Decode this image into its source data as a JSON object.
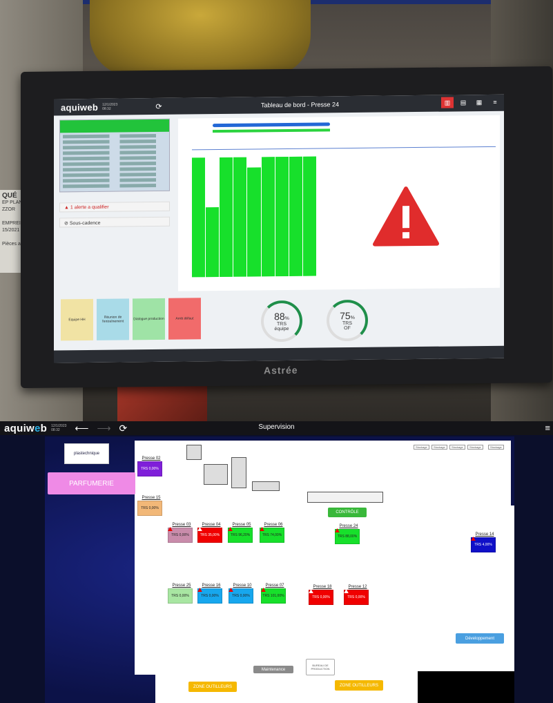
{
  "photo": {
    "sticker_lines": [
      "QUÉ",
      "EP PLAN ETT",
      "ZZOR",
      "EMPREINTE(S)",
      "15/2021",
      "Pièces avec"
    ],
    "bezel_brand": "Astrée"
  },
  "screen": {
    "logo": "aquiweb",
    "date_line1": "12/1/2023",
    "date_line2": "08:32",
    "refresh_icon": "refresh-icon",
    "title": "Tableau de bord - Presse 24",
    "header_icons": [
      "chart-icon",
      "list-icon",
      "calendar-icon",
      "menu-icon"
    ],
    "alert_text": "1 alerte a qualifier",
    "perf_text": "Sous-cadence",
    "tiles": [
      {
        "label": "Equipe HH",
        "color": "#f1e3a4"
      },
      {
        "label": "Réunion de l'entraînement",
        "color": "#a9dbe8"
      },
      {
        "label": "Dialogue production",
        "color": "#9fe3a6"
      },
      {
        "label": "Arrêt défaut",
        "color": "#f16b6b"
      }
    ],
    "gauge1": {
      "value": "88",
      "unit": "%",
      "l1": "TRS",
      "l2": "équipe"
    },
    "gauge2": {
      "value": "75",
      "unit": "%",
      "l1": "TRS",
      "l2": "OF"
    }
  },
  "app": {
    "logo_a": "aquiw",
    "logo_b": "e",
    "logo_c": "b",
    "date_line1": "12/1/2023",
    "date_line2": "08:32",
    "title": "Supervision",
    "back_icon": "arrow-left-icon",
    "forward_icon": "arrow-right-icon",
    "refresh_icon": "refresh-icon",
    "menu_icon": "menu-icon",
    "logo_box_text": "plastechnique",
    "zone_parfumerie": "PARFUMERIE",
    "zone_controle": "CONTRÔLE",
    "zone_developpement": "Développement",
    "zone_maintenance": "Maintenance",
    "zone_bureau": "BUREAU DE PRODUCTION",
    "zone_outilleurs_1": "ZONE OUTILLEURS",
    "zone_outilleurs_2": "ZONE OUTILLEURS",
    "stockage": "Stockage",
    "presses": [
      {
        "name": "Presse 02",
        "trs": "TRS 0,00%",
        "color": "#7f1fd9",
        "warn": false
      },
      {
        "name": "Presse 15",
        "trs": "TRS 0,00%",
        "color": "#f2b878",
        "warn": false
      },
      {
        "name": "Presse 03",
        "trs": "TRS 0,00%",
        "color": "#c98cab",
        "warn": true
      },
      {
        "name": "Presse 04",
        "trs": "TRS 35,00%",
        "color": "#f00000",
        "warn": true
      },
      {
        "name": "Presse 05",
        "trs": "TRS 96,20%",
        "color": "#17e02b",
        "warn": true
      },
      {
        "name": "Presse 06",
        "trs": "TRS 74,00%",
        "color": "#17e02b",
        "warn": true
      },
      {
        "name": "Presse 24",
        "trs": "TRS 88,00%",
        "color": "#17e02b",
        "warn": true
      },
      {
        "name": "Presse 14",
        "trs": "TRS 4,00%",
        "color": "#1010c8",
        "warn": true
      },
      {
        "name": "Presse 25",
        "trs": "TRS 0,00%",
        "color": "#a8e6a2",
        "warn": false
      },
      {
        "name": "Presse 16",
        "trs": "TRS 0,00%",
        "color": "#17a7ee",
        "warn": true
      },
      {
        "name": "Presse 10",
        "trs": "TRS 0,00%",
        "color": "#17a7ee",
        "warn": true
      },
      {
        "name": "Presse 07",
        "trs": "TRS 101,00%",
        "color": "#17e02b",
        "warn": true
      },
      {
        "name": "Presse 18",
        "trs": "TRS 0,00%",
        "color": "#f00000",
        "warn": true
      },
      {
        "name": "Presse 12",
        "trs": "TRS 0,00%",
        "color": "#f00000",
        "warn": true
      }
    ]
  }
}
